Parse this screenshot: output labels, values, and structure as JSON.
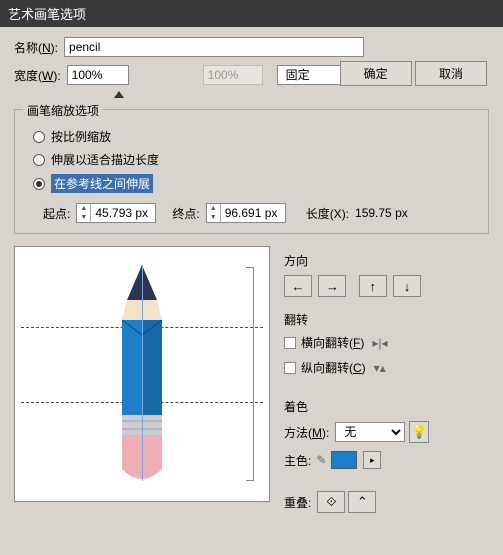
{
  "window_title": "艺术画笔选项",
  "labels": {
    "name": "名称(N):",
    "width": "宽度(W):",
    "start": "起点:",
    "end": "终点:",
    "length": "长度(X):",
    "direction": "方向",
    "flip": "翻转",
    "flip_h": "横向翻转(F)",
    "flip_v": "纵向翻转(C)",
    "color": "着色",
    "method": "方法(M):",
    "main": "主色:",
    "overlap": "重叠:"
  },
  "name_value": "pencil",
  "width_value": "100%",
  "width_pct_ghost": "100%",
  "width_mode": "固定",
  "buttons": {
    "ok": "确定",
    "cancel": "取消"
  },
  "group_title": "画笔缩放选项",
  "scale_options": [
    "按比例缩放",
    "伸展以适合描边长度",
    "在参考线之间伸展"
  ],
  "selected_scale": 2,
  "start_val": "45.793 px",
  "end_val": "96.691 px",
  "length_val": "159.75 px",
  "method_value": "无",
  "main_color": "#1b7fc9",
  "dir_arrows": [
    "←",
    "→",
    "↑",
    "↓"
  ]
}
